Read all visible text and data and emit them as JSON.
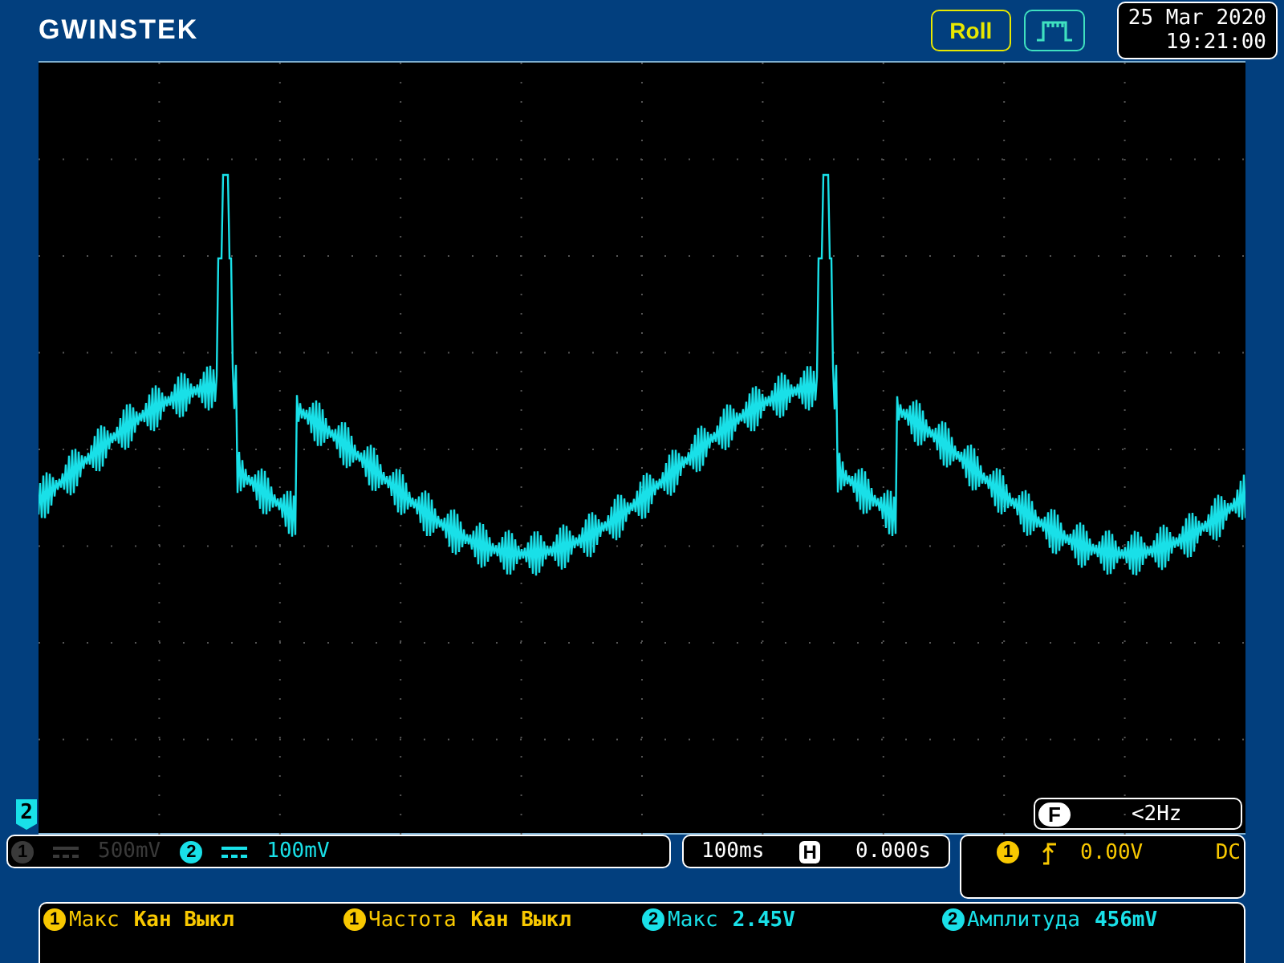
{
  "header": {
    "logo": "GWINSTEK",
    "mode_button": "Roll",
    "date": "25 Mar 2020",
    "time": "19:21:00"
  },
  "screen": {
    "channel_marker": "2",
    "frequency_badge": "F",
    "frequency": "<2Hz"
  },
  "channels": [
    {
      "number": "1",
      "scale": "500mV",
      "on": false
    },
    {
      "number": "2",
      "scale": "100mV",
      "on": true
    }
  ],
  "timebase": {
    "scale": "100ms",
    "badge": "H",
    "position": "0.000s"
  },
  "trigger": {
    "source": "1",
    "level": "0.00V",
    "coupling": "DC"
  },
  "measurements": [
    {
      "source": "1",
      "label": "Макс",
      "value": "Кан Выкл"
    },
    {
      "source": "1",
      "label": "Частота",
      "value": "Кан Выкл"
    },
    {
      "source": "2",
      "label": "Макс",
      "value": "2.45V"
    },
    {
      "source": "2",
      "label": "Амплитуда",
      "value": "456mV"
    }
  ]
}
